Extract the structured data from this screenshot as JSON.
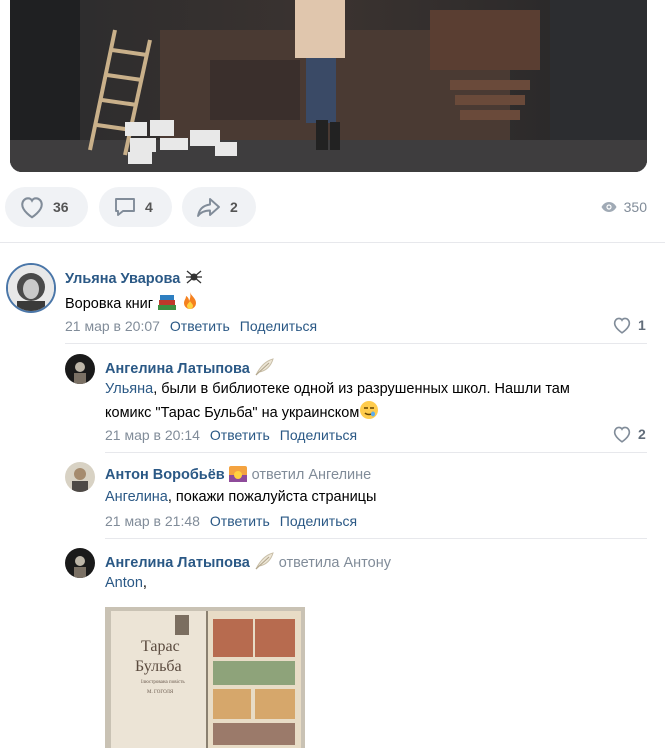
{
  "post": {
    "likes": "36",
    "comments": "4",
    "shares": "2",
    "views": "350"
  },
  "comments": [
    {
      "author": "Ульяна Уварова",
      "text": "Воровка книг",
      "date": "21 мар в 20:07",
      "reply": "Ответить",
      "share": "Поделиться",
      "likes": "1"
    },
    {
      "author": "Ангелина Латыпова",
      "mention": "Ульяна",
      "text_line1": ", были в библиотеке одной из разрушенных школ. Нашли там",
      "text_line2": "комикс \"Тарас Бульба\" на украинском",
      "date": "21 мар в 20:14",
      "reply": "Ответить",
      "share": "Поделиться",
      "likes": "2"
    },
    {
      "author": "Антон Воробьёв",
      "reply_to": "ответил Ангелине",
      "mention": "Ангелина",
      "text": ", покажи пожалуйста страницы",
      "date": "21 мар в 21:48",
      "reply": "Ответить",
      "share": "Поделиться"
    },
    {
      "author": "Ангелина Латыпова",
      "reply_to": "ответила Антону",
      "mention": "Anton",
      "text": ","
    }
  ],
  "book": {
    "title_line1": "Тарас",
    "title_line2": "Бульба",
    "subtitle": "Ілюстрована повість",
    "author": "М. ГОГОЛЯ"
  },
  "icons": [
    "heart-icon",
    "comment-icon",
    "share-icon",
    "eye-icon",
    "spider-icon",
    "books-icon",
    "fire-icon",
    "feather-icon",
    "sunset-icon",
    "smile-icon"
  ]
}
